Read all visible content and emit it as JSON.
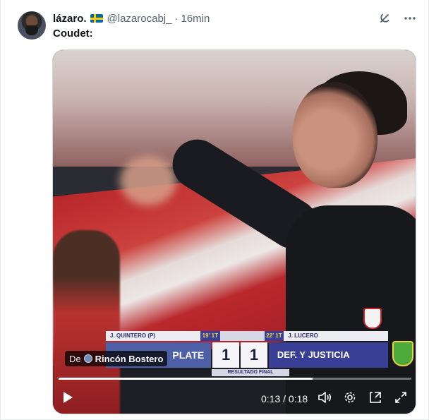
{
  "tweet": {
    "author_name": "lázaro.",
    "handle": "@lazarocabj_",
    "separator": "·",
    "time": "16min",
    "text": "Coudet:"
  },
  "video": {
    "source_prefix": "De",
    "source_name": "Rincón Bostero",
    "current_time": "0:13",
    "time_separator": "/",
    "duration": "0:18",
    "progress_fraction": 0.72,
    "scoreboard": {
      "left_scorer": "J. QUINTERO (P)",
      "left_minute": "19' 1T",
      "right_minute": "22' 1T",
      "right_scorer": "J. LUCERO",
      "home_team": "PLATE",
      "home_score": "1",
      "away_score": "1",
      "away_team": "DEF. Y JUSTICIA",
      "status": "RESULTADO FINAL"
    }
  },
  "icons": {
    "grok": "grok-icon",
    "more": "more-icon",
    "play": "play-icon",
    "volume": "volume-icon",
    "settings": "gear-icon",
    "pip": "picture-in-picture-icon",
    "fullscreen": "fullscreen-icon",
    "flag": "sweden-flag-icon"
  },
  "colors": {
    "text_primary": "#0f1419",
    "text_secondary": "#536471",
    "media_border": "#cfd9de"
  }
}
